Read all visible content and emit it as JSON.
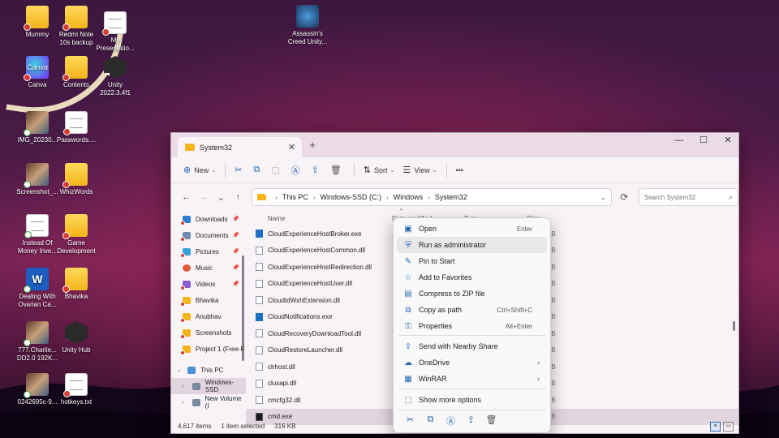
{
  "desktop": {
    "icons": [
      {
        "label": "Mummy",
        "type": "folder"
      },
      {
        "label": "Redmi Note\n10s backup",
        "type": "folder"
      },
      {
        "label": "My\nPresentatio...",
        "type": "doc"
      },
      {
        "label": "Assassin's\nCreed Unity...",
        "type": "game"
      },
      {
        "label": "Canva",
        "type": "canva"
      },
      {
        "label": "Contents",
        "type": "folder"
      },
      {
        "label": "Unity\n2022.3.4f1",
        "type": "unity"
      },
      {
        "label": "IMG_20230...",
        "type": "photo"
      },
      {
        "label": "Passwords....",
        "type": "doc"
      },
      {
        "label": "Screenshot_...",
        "type": "photo"
      },
      {
        "label": "WhizWords",
        "type": "folder"
      },
      {
        "label": "Instead Of\nMoney Inve...",
        "type": "doc"
      },
      {
        "label": "Game\nDevelopment",
        "type": "folder"
      },
      {
        "label": "Dealing With\nOvarian Ca...",
        "type": "word"
      },
      {
        "label": "Bhavika",
        "type": "folder"
      },
      {
        "label": "777.Charlie...\nDD2.0 192K...",
        "type": "photo"
      },
      {
        "label": "Unity Hub",
        "type": "unity"
      },
      {
        "label": "0242695c-9...",
        "type": "photo"
      },
      {
        "label": "hotkeys.txt",
        "type": "doc"
      }
    ]
  },
  "window": {
    "tab_title": "System32",
    "tab_close": "✕",
    "new_tab": "+",
    "controls": {
      "minimize": "—",
      "maximize": "☐",
      "close": "✕"
    },
    "toolbar": {
      "new_label": "New",
      "sort_label": "Sort",
      "view_label": "View",
      "more_label": "•••"
    },
    "address": {
      "crumbs": [
        "This PC",
        "Windows-SSD (C:)",
        "Windows",
        "System32"
      ],
      "search_placeholder": "Search System32"
    },
    "nav": [
      {
        "label": "Downloads",
        "icon": "dl",
        "pinned": true
      },
      {
        "label": "Documents",
        "icon": "doc",
        "pinned": true
      },
      {
        "label": "Pictures",
        "icon": "pic",
        "pinned": true
      },
      {
        "label": "Music",
        "icon": "mus",
        "pinned": true
      },
      {
        "label": "Videos",
        "icon": "vid",
        "pinned": true
      },
      {
        "label": "Bhavika",
        "icon": "fold",
        "pinned": false
      },
      {
        "label": "Anubhav",
        "icon": "fold",
        "pinned": false
      },
      {
        "label": "Screenshots",
        "icon": "fold",
        "pinned": false
      },
      {
        "label": "Project 1 (Free-F",
        "icon": "fold",
        "pinned": false
      },
      {
        "label": "This PC",
        "icon": "pc",
        "pinned": false
      },
      {
        "label": "Windows-SSD",
        "icon": "drive",
        "pinned": false
      },
      {
        "label": "New Volume (I",
        "icon": "drive",
        "pinned": false
      }
    ],
    "columns": {
      "name": "Name",
      "date": "Date modified",
      "type": "Type",
      "size": "Size"
    },
    "files": [
      {
        "name": "CloudExperienceHostBroker.exe",
        "kind": "exe",
        "size": "KB"
      },
      {
        "name": "CloudExperienceHostCommon.dll",
        "kind": "dll",
        "size": "KB"
      },
      {
        "name": "CloudExperienceHostRedirection.dll",
        "kind": "dll",
        "size": "KB"
      },
      {
        "name": "CloudExperienceHostUser.dll",
        "kind": "dll",
        "size": "KB"
      },
      {
        "name": "CloudIdWxhExtension.dll",
        "kind": "dll",
        "size": "KB"
      },
      {
        "name": "CloudNotifications.exe",
        "kind": "exe",
        "size": "KB"
      },
      {
        "name": "CloudRecoveryDownloadTool.dll",
        "kind": "dll",
        "size": "KB"
      },
      {
        "name": "CloudRestoreLauncher.dll",
        "kind": "dll",
        "size": "KB"
      },
      {
        "name": "clrhost.dll",
        "kind": "dll",
        "size": "KB"
      },
      {
        "name": "clusapi.dll",
        "kind": "dll",
        "size": "KB"
      },
      {
        "name": "cmcfg32.dll",
        "kind": "dll",
        "size": "KB"
      },
      {
        "name": "cmd.exe",
        "kind": "cmd",
        "size": "KB"
      }
    ],
    "status": {
      "count": "4,617 items",
      "selected": "1 item selected",
      "size": "316 KB"
    }
  },
  "context_menu": {
    "items": [
      {
        "label": "Open",
        "shortcut": "Enter",
        "icon": "▣"
      },
      {
        "label": "Run as administrator",
        "shortcut": "",
        "icon": "⛨"
      },
      {
        "label": "Pin to Start",
        "shortcut": "",
        "icon": "✎"
      },
      {
        "label": "Add to Favorites",
        "shortcut": "",
        "icon": "☆"
      },
      {
        "label": "Compress to ZIP file",
        "shortcut": "",
        "icon": "▤"
      },
      {
        "label": "Copy as path",
        "shortcut": "Ctrl+Shift+C",
        "icon": "⧉"
      },
      {
        "label": "Properties",
        "shortcut": "Alt+Enter",
        "icon": "⚿"
      },
      {
        "label": "Send with Nearby Share",
        "shortcut": "",
        "icon": "⇪"
      },
      {
        "label": "OneDrive",
        "shortcut": "",
        "icon": "☁"
      },
      {
        "label": "WinRAR",
        "shortcut": "",
        "icon": "▦"
      },
      {
        "label": "Show more options",
        "shortcut": "",
        "icon": "⬚"
      }
    ],
    "submenu_arrow": "›"
  },
  "colors": {
    "accent": "#2466b3",
    "hover": "#e8e8e8",
    "selection": "#e3d5df"
  }
}
